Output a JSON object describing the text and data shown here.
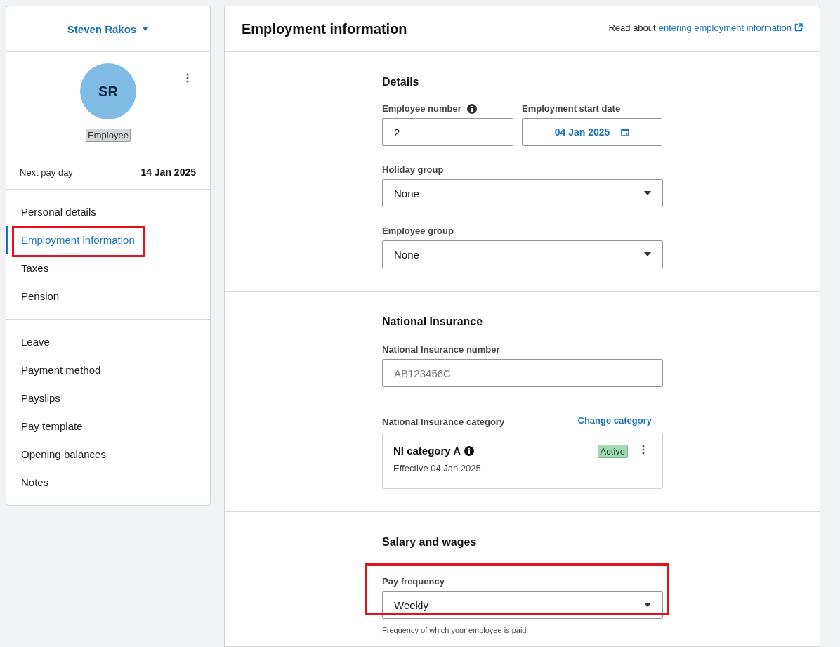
{
  "employee_menu": {
    "name": "Steven Rakos"
  },
  "profile": {
    "initials": "SR",
    "role": "Employee"
  },
  "next_pay_day": {
    "label": "Next pay day",
    "value": "14 Jan 2025"
  },
  "nav_groups": [
    [
      {
        "label": "Personal details",
        "selected": false,
        "highlighted": false
      },
      {
        "label": "Employment information",
        "selected": true,
        "highlighted": true
      },
      {
        "label": "Taxes",
        "selected": false,
        "highlighted": false
      },
      {
        "label": "Pension",
        "selected": false,
        "highlighted": false
      }
    ],
    [
      {
        "label": "Leave",
        "selected": false,
        "highlighted": false
      },
      {
        "label": "Payment method",
        "selected": false,
        "highlighted": false
      },
      {
        "label": "Payslips",
        "selected": false,
        "highlighted": false
      },
      {
        "label": "Pay template",
        "selected": false,
        "highlighted": false
      },
      {
        "label": "Opening balances",
        "selected": false,
        "highlighted": false
      },
      {
        "label": "Notes",
        "selected": false,
        "highlighted": false
      }
    ]
  ],
  "page": {
    "title": "Employment information",
    "help_prefix": "Read about",
    "help_link": "entering employment information"
  },
  "sections": [
    {
      "title": "Details",
      "fields": [
        {
          "kind": "row",
          "fields": [
            {
              "kind": "text",
              "label": "Employee number",
              "value": "2",
              "info": true
            },
            {
              "kind": "date",
              "label": "Employment start date",
              "value": "04 Jan 2025"
            }
          ]
        },
        {
          "kind": "select",
          "label": "Holiday group",
          "value": "None",
          "highlighted": false
        },
        {
          "kind": "select",
          "label": "Employee group",
          "value": "None",
          "highlighted": false
        }
      ]
    },
    {
      "title": "National Insurance",
      "fields": [
        {
          "kind": "text",
          "label": "National Insurance number",
          "placeholder": "AB123456C"
        },
        {
          "kind": "ni_category",
          "label": "National Insurance category",
          "action": "Change category",
          "card_title": "NI category A",
          "card_sub": "Effective 04 Jan 2025",
          "status": "Active"
        }
      ]
    },
    {
      "title": "Salary and wages",
      "fields": [
        {
          "kind": "select",
          "label": "Pay frequency",
          "value": "Weekly",
          "highlighted": true,
          "hint": "Frequency of which your employee is paid"
        }
      ]
    }
  ]
}
